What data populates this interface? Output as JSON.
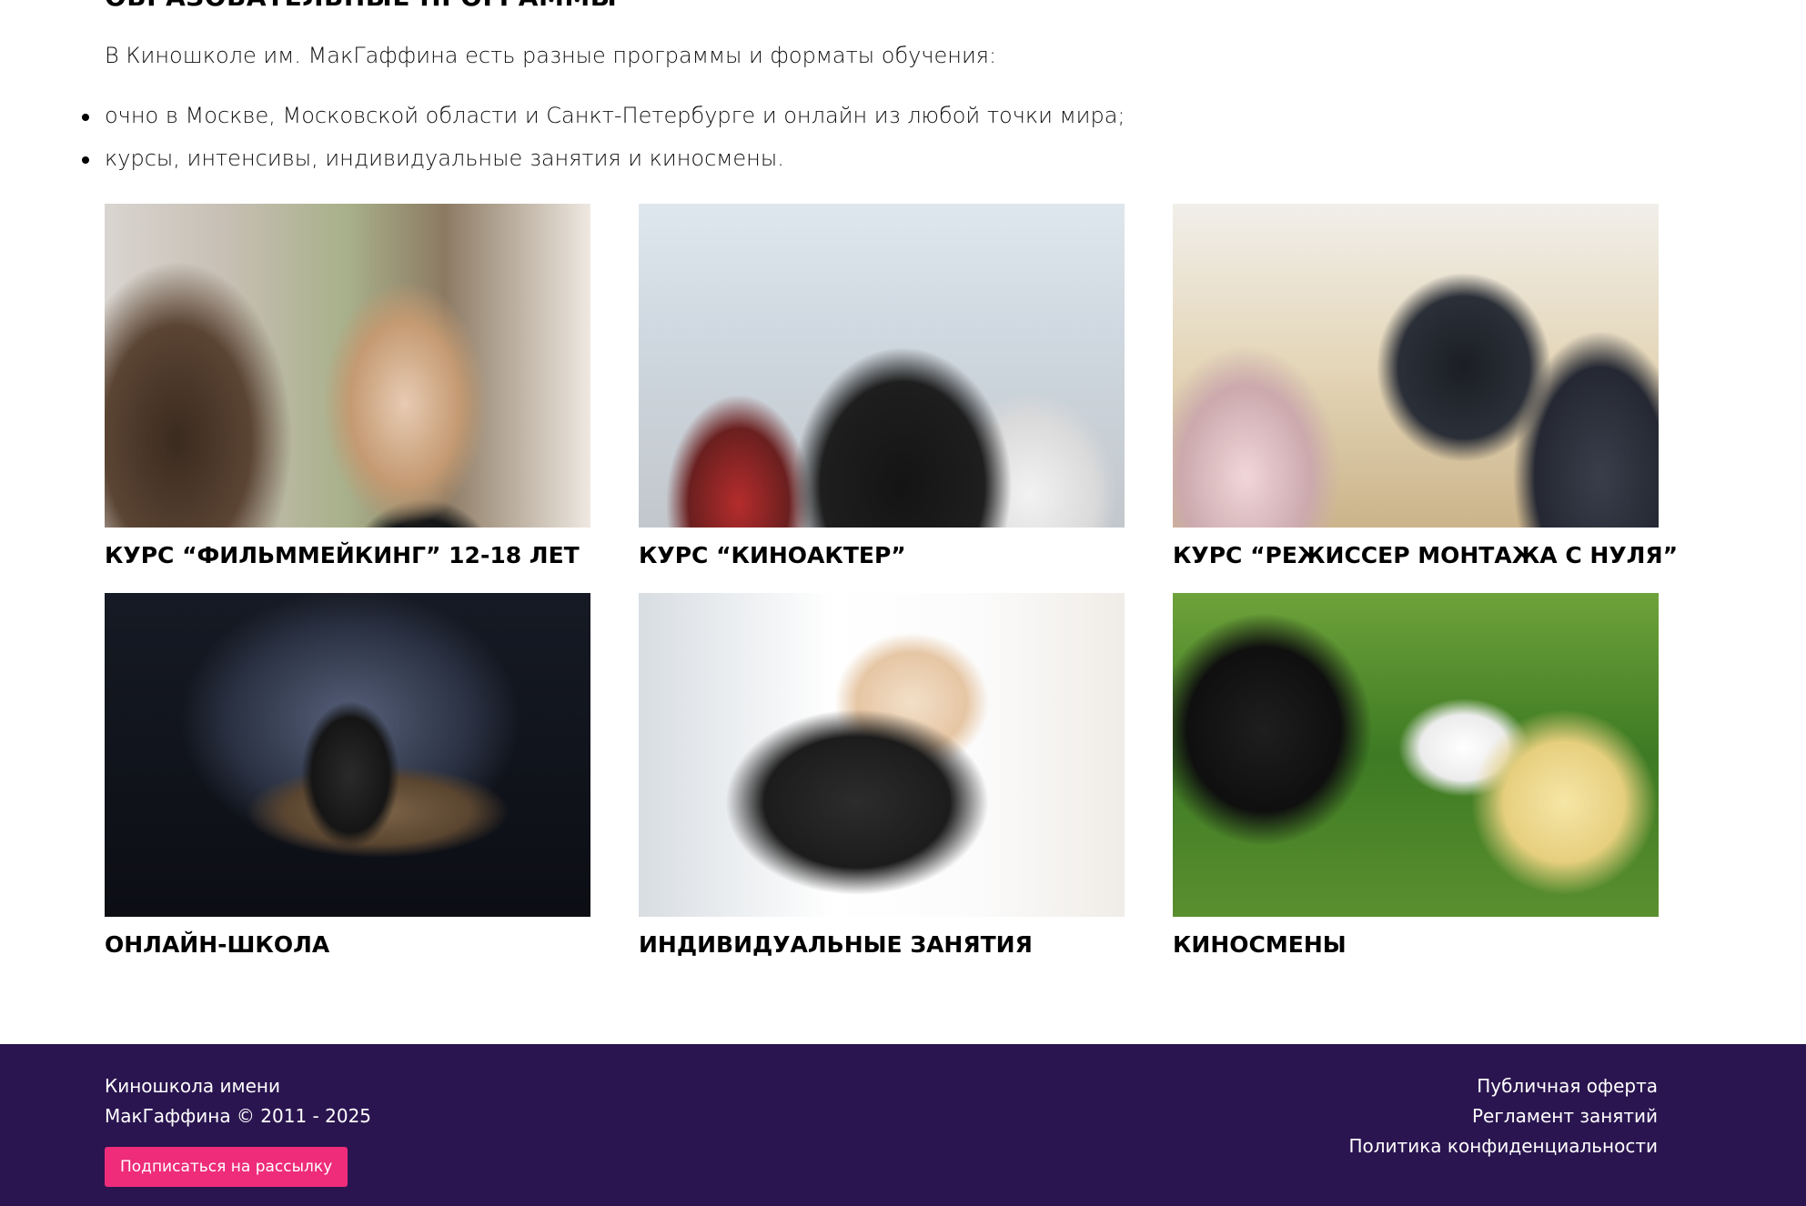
{
  "section": {
    "title": "ОБРАЗОВАТЕЛЬНЫЕ ПРОГРАММЫ",
    "intro": "В Киношколе им. МакГаффина есть разные программы и форматы обучения:",
    "bullets": [
      "очно в Москве, Московской области и Санкт-Петербурге и онлайн из любой точки мира;",
      "курсы, интенсивы, индивидуальные занятия и киносмены."
    ]
  },
  "programs": [
    {
      "title": "КУРС “ФИЛЬММЕЙКИНГ” 12-18 ЛЕТ"
    },
    {
      "title": "КУРС “КИНОАКТЕР”"
    },
    {
      "title": "КУРС “РЕЖИССЕР МОНТАЖА С НУЛЯ”"
    },
    {
      "title": "ОНЛАЙН-ШКОЛА"
    },
    {
      "title": "ИНДИВИДУАЛЬНЫЕ ЗАНЯТИЯ"
    },
    {
      "title": "КИНОСМЕНЫ"
    }
  ],
  "footer": {
    "copyright_line1": "Киношкола имени",
    "copyright_line2": "МакГаффина © 2011 - 2025",
    "subscribe_label": "Подписаться на рассылку",
    "links": [
      "Публичная оферта",
      "Регламент занятий",
      "Политика конфиденциальности"
    ]
  },
  "colors": {
    "footer_bg": "#2a1550",
    "accent": "#ee2c7a",
    "text": "#111111"
  }
}
